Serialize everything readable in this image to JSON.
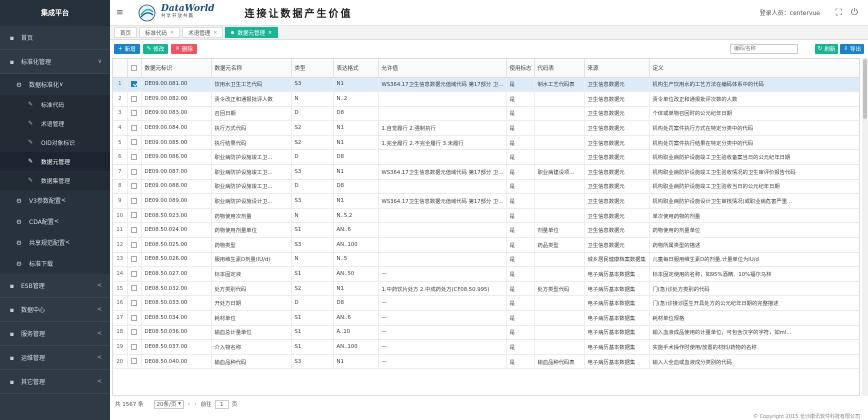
{
  "sidebar": {
    "brand": "集成平台",
    "items": [
      {
        "icon": "▪",
        "label": "首页",
        "level": 1,
        "arrow": ""
      },
      {
        "icon": "▪",
        "label": "标准化管理",
        "level": 1,
        "arrow": "∨"
      },
      {
        "icon": "⚙",
        "label": "数据标准化",
        "level": 2,
        "arrow": "∨"
      },
      {
        "icon": "✎",
        "label": "标准代码",
        "level": 3
      },
      {
        "icon": "✎",
        "label": "术语管理",
        "level": 3
      },
      {
        "icon": "✎",
        "label": "OID对象标识",
        "level": 3
      },
      {
        "icon": "✎",
        "label": "数据元管理",
        "level": 3,
        "active": true
      },
      {
        "icon": "✎",
        "label": "数据集管理",
        "level": 3
      },
      {
        "icon": "⚙",
        "label": "V3参数配置",
        "level": 2,
        "arrow": "<"
      },
      {
        "icon": "⚙",
        "label": "CDA配置",
        "level": 2,
        "arrow": "<"
      },
      {
        "icon": "⚙",
        "label": "共享规范配置",
        "level": 2,
        "arrow": "<"
      },
      {
        "icon": "⚙",
        "label": "标准下载",
        "level": 2,
        "arrow": ""
      },
      {
        "icon": "▪",
        "label": "ESB管理",
        "level": 1,
        "arrow": "<"
      },
      {
        "icon": "▪",
        "label": "数据中心",
        "level": 1,
        "arrow": "<"
      },
      {
        "icon": "▪",
        "label": "服务管理",
        "level": 1,
        "arrow": "<"
      },
      {
        "icon": "▪",
        "label": "运维管理",
        "level": 1,
        "arrow": "<"
      },
      {
        "icon": "▪",
        "label": "其它管理",
        "level": 1,
        "arrow": "<"
      }
    ]
  },
  "header": {
    "menu_icon": "≡",
    "logo_title": "DataWorld",
    "logo_sub": "共享开放共赢",
    "slogan": "连接让数据产生价值",
    "user_label": "登录人员：centervue",
    "icons": [
      "⛶",
      "⏻"
    ]
  },
  "tabs": [
    {
      "label": "首页",
      "closable": false,
      "active": false
    },
    {
      "label": "标准代码",
      "closable": true,
      "active": false
    },
    {
      "label": "术语管理",
      "closable": true,
      "active": false
    },
    {
      "label": "数据元管理",
      "closable": true,
      "active": true
    }
  ],
  "toolbar": {
    "add_label": "新增",
    "edit_label": "修改",
    "delete_label": "删除",
    "search_placeholder": "编码/名称",
    "refresh_label": "刷新",
    "export_label": "导出"
  },
  "table": {
    "columns": [
      "",
      "",
      "数据元标识",
      "数据元名称",
      "类型",
      "表达格式",
      "允许值",
      "使用标志",
      "代码表",
      "来源",
      "定义"
    ],
    "rows": [
      [
        "1",
        true,
        "DE09.00.081.00",
        "饮用水卫生工艺代码",
        "S3",
        "N1",
        "WS364.17卫生信息数据元值域代码 第17部分 卫生...",
        "是",
        "制水工艺代码表",
        "卫生信息数据元",
        "机构生产饮用水的工艺方法在编码体系中的代码"
      ],
      [
        "2",
        false,
        "DE09.00.082.00",
        "责令改正和通报批评人数",
        "N",
        "N..2",
        "",
        "是",
        "",
        "卫生信息数据元",
        "责令单位改正和通报批评次数的人数"
      ],
      [
        "3",
        false,
        "DE09.00.083.00",
        "召回日期",
        "D",
        "D8",
        "",
        "是",
        "",
        "卫生信息数据元",
        "个体或单物召回时的公元纪年日期"
      ],
      [
        "4",
        false,
        "DE09.00.084.00",
        "执行方式代码",
        "S2",
        "N1",
        "1.自觉履行 2.强制执行",
        "是",
        "",
        "卫生信息数据元",
        "机构处罚案件执行方式在特定分类中的代码"
      ],
      [
        "5",
        false,
        "DE09.00.085.00",
        "执行结果代码",
        "S2",
        "N1",
        "1.完全履行 2.不完全履行 3.未履行",
        "是",
        "",
        "卫生信息数据元",
        "机构处罚案件执行结果在特定分类中的代码"
      ],
      [
        "6",
        false,
        "DE09.00.086.00",
        "职业病防护设施竣工卫...",
        "D",
        "D8",
        "",
        "是",
        "",
        "卫生信息数据元",
        "机构职业病防护设施竣工卫生验收备案当日的公元纪年日期"
      ],
      [
        "7",
        false,
        "DE09.00.087.00",
        "职业病防护设施竣工卫...",
        "S3",
        "N1",
        "WS364.17卫生信息数据元值域代码 第17部分 卫生...",
        "是",
        "职业病建设项...",
        "卫生信息数据元",
        "机构职业病防护设施竣工卫生验收情况的卫生审评价报告代码"
      ],
      [
        "8",
        false,
        "DE09.00.088.00",
        "职业病防护设施竣工卫...",
        "D",
        "D8",
        "",
        "是",
        "",
        "卫生信息数据元",
        "机构职业病防护设施竣工卫生验收当日的公元纪年日期"
      ],
      [
        "9",
        false,
        "DE09.00.089.00",
        "职业病防护设施设计卫...",
        "S3",
        "N1",
        "WS364.17卫生信息数据元值域代码 第17部分 卫生...",
        "是",
        "",
        "卫生信息数据元",
        "机构职业病防护设施设计卫生审核情况(或职业病危害严重..."
      ],
      [
        "10",
        false,
        "DE08.50.023.00",
        "药物使用次剂量",
        "N",
        "N..5,2",
        "",
        "是",
        "",
        "卫生信息数据元",
        "单次使用药物的剂量"
      ],
      [
        "11",
        false,
        "DE08.50.024.00",
        "药物使用剂量单位",
        "S1",
        "AN..6",
        "",
        "是",
        "剂量单位",
        "卫生信息数据元",
        "药物使用的剂量单位"
      ],
      [
        "12",
        false,
        "DE08.50.025.00",
        "药物类型",
        "S3",
        "AN..100",
        "",
        "是",
        "药品类型",
        "卫生信息数据元",
        "药物所属类型的描述"
      ],
      [
        "13",
        false,
        "DE08.50.026.00",
        "服用维生素D剂量(IU/d)",
        "N",
        "N..5",
        "",
        "是",
        "",
        "城乡居民健康档案数据集",
        "儿童每日服用维生素D的剂量,计量单位为IU/d"
      ],
      [
        "14",
        false,
        "DE08.50.027.00",
        "标本固定液",
        "S1",
        "AN..50",
        "—",
        "是",
        "",
        "电子病历基本数据集",
        "标本固定使用的名称，如95%酒精、10%福尔马林"
      ],
      [
        "15",
        false,
        "DE08.50.032.00",
        "处方类别代码",
        "S2",
        "N1",
        "1.中药饮片处方 2.中成药处方(CF08.50.995)",
        "是",
        "处方类型代码",
        "电子病历基本数据集",
        "门(急)诊处方类别的代码"
      ],
      [
        "16",
        false,
        "DE08.50.033.00",
        "开处方日期",
        "D",
        "D8",
        "—",
        "是",
        "",
        "电子病历基本数据集",
        "门(急)诊接诊医生开具处方的公元纪年日期的完整描述"
      ],
      [
        "17",
        false,
        "DE08.50.034.00",
        "耗材单位",
        "S1",
        "AN..6",
        "—",
        "是",
        "",
        "电子病历基本数据集",
        "耗材单位规格"
      ],
      [
        "18",
        false,
        "DE08.50.036.00",
        "输血总计量单位",
        "S1",
        "A..10",
        "—",
        "是",
        "",
        "电子病历基本数据集",
        "输入血液成品使用的计量单位，可包含汉字的字符，如ml..."
      ],
      [
        "19",
        false,
        "DE08.50.037.00",
        "介入物名称",
        "S1",
        "AN..100",
        "—",
        "是",
        "",
        "电子病历基本数据集",
        "实施手术操作时使用/放置的材料/药物的名称"
      ],
      [
        "20",
        false,
        "DE08.50.040.00",
        "输血品种代码",
        "S3",
        "N1",
        "—",
        "是",
        "输血品种代码表",
        "电子病历基本数据集",
        "输入人全血或血液成分类别的代码"
      ]
    ]
  },
  "pager": {
    "total": "共 1567 条",
    "page_size": "20条/页",
    "goto_label": "前往",
    "page": "1",
    "page_suffix": "页"
  },
  "footer": {
    "copyright": "© Copyright 2015 长沙康讯软件科技有限公司"
  },
  "colors": {
    "sidebar_bg": "#2f3a45",
    "accent_green": "#1ab394",
    "accent_blue": "#1c84c6",
    "accent_red": "#ed5565",
    "selected_row": "#dcebf7"
  }
}
